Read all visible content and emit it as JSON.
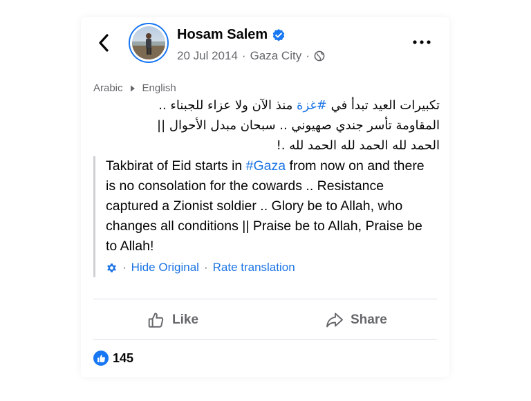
{
  "post": {
    "author": "Hosam Salem",
    "verified_icon": "verified-badge-icon",
    "date": "20 Jul 2014",
    "separator": "·",
    "location": "Gaza City",
    "audience_icon": "globe-icon",
    "source_language": "Arabic",
    "target_language": "English",
    "original_text": {
      "line1_before": "تكبيرات العيد تبدأ في ",
      "line1_tag": "#غزة",
      "line1_after": " منذ الآن ولا عزاء للجبناء ..",
      "line2": "المقاومة تأسر جندي صهيوني .. سبحان مبدل الأحوال ||",
      "line3": "الحمد لله الحمد لله الحمد لله .!"
    },
    "translation": {
      "before": "Takbirat of Eid starts in ",
      "tag": "#Gaza",
      "after": " from now on and there is no consolation for the cowards .. Resistance captured a Zionist soldier .. Glory be to Allah, who changes all conditions || Praise be to Allah, Praise be to Allah!"
    },
    "hide_original_label": "Hide Original",
    "rate_translation_label": "Rate translation"
  },
  "actions": {
    "like_label": "Like",
    "share_label": "Share"
  },
  "reactions": {
    "like_count": "145"
  },
  "colors": {
    "accent": "#1877f2",
    "link": "#1b74e4",
    "secondary_text": "#65676b",
    "divider": "#dadde1"
  }
}
